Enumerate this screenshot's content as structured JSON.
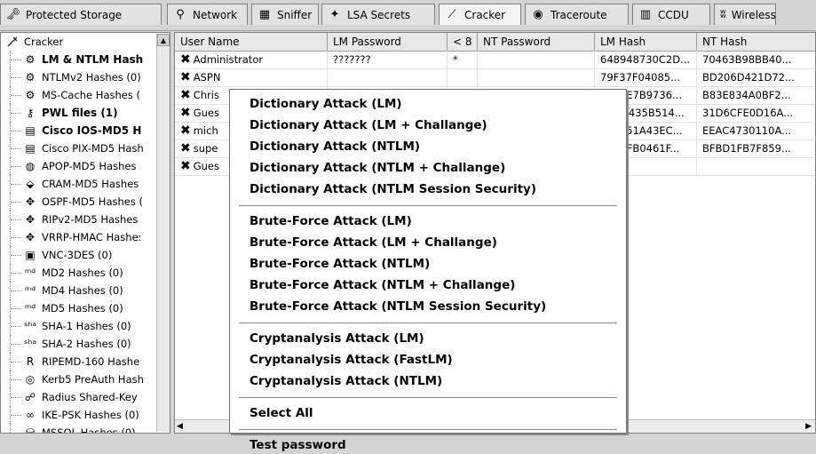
{
  "tabs": [
    {
      "label": "Protected Storage",
      "icon": "key-icon"
    },
    {
      "label": "Network",
      "icon": "network-icon"
    },
    {
      "label": "Sniffer",
      "icon": "sniffer-icon"
    },
    {
      "label": "LSA Secrets",
      "icon": "lsa-icon"
    },
    {
      "label": "Cracker",
      "icon": "cracker-icon"
    },
    {
      "label": "Traceroute",
      "icon": "traceroute-icon"
    },
    {
      "label": "CCDU",
      "icon": "ccdu-icon"
    },
    {
      "label": "Wireless",
      "icon": "wireless-icon"
    }
  ],
  "tree": {
    "root": "Cracker",
    "items": [
      {
        "label": "LM & NTLM Hash",
        "bold": true,
        "icon": "hash-icon"
      },
      {
        "label": "NTLMv2 Hashes (0)",
        "bold": false,
        "icon": "hash-icon"
      },
      {
        "label": "MS-Cache Hashes (",
        "bold": false,
        "icon": "hash-icon"
      },
      {
        "label": "PWL files (1)",
        "bold": true,
        "icon": "pwl-icon"
      },
      {
        "label": "Cisco IOS-MD5 H",
        "bold": true,
        "icon": "cisco-icon"
      },
      {
        "label": "Cisco PIX-MD5 Hash",
        "bold": false,
        "icon": "cisco-icon"
      },
      {
        "label": "APOP-MD5 Hashes",
        "bold": false,
        "icon": "apop-icon"
      },
      {
        "label": "CRAM-MD5 Hashes",
        "bold": false,
        "icon": "cram-icon"
      },
      {
        "label": "OSPF-MD5 Hashes (",
        "bold": false,
        "icon": "cross-arrows-icon"
      },
      {
        "label": "RIPv2-MD5 Hashes",
        "bold": false,
        "icon": "cross-arrows-icon"
      },
      {
        "label": "VRRP-HMAC Hashe:",
        "bold": false,
        "icon": "cross-arrows-icon"
      },
      {
        "label": "VNC-3DES (0)",
        "bold": false,
        "icon": "vnc-icon"
      },
      {
        "label": "MD2 Hashes (0)",
        "bold": false,
        "icon": "md-icon"
      },
      {
        "label": "MD4 Hashes (0)",
        "bold": false,
        "icon": "md-icon"
      },
      {
        "label": "MD5 Hashes (0)",
        "bold": false,
        "icon": "md-icon"
      },
      {
        "label": "SHA-1 Hashes (0)",
        "bold": false,
        "icon": "sha-icon"
      },
      {
        "label": "SHA-2 Hashes (0)",
        "bold": false,
        "icon": "sha-icon"
      },
      {
        "label": "RIPEMD-160 Hashe",
        "bold": false,
        "icon": "ripemd-icon"
      },
      {
        "label": "Kerb5 PreAuth Hash",
        "bold": false,
        "icon": "kerberos-icon"
      },
      {
        "label": "Radius Shared-Key",
        "bold": false,
        "icon": "radius-icon"
      },
      {
        "label": "IKE-PSK Hashes (0)",
        "bold": false,
        "icon": "ike-icon"
      },
      {
        "label": "MSSQL Hashes (0)",
        "bold": false,
        "icon": "mssql-icon"
      }
    ]
  },
  "table": {
    "headers": [
      "User Name",
      "LM Password",
      "< 8",
      "NT Password",
      "LM Hash",
      "NT Hash"
    ],
    "rows": [
      [
        "Administrator",
        "???????",
        "*",
        "",
        "648948730C2D...",
        "70463B98BB40..."
      ],
      [
        "ASPN",
        "",
        "",
        "",
        "79F37F04085...",
        "BD206D421D72..."
      ],
      [
        "Chris",
        "",
        "",
        "",
        "5019E7B9736...",
        "B83E834A0BF2..."
      ],
      [
        "Gues",
        "",
        "",
        "",
        "AD3B435B514...",
        "31D6CFE0D16A..."
      ],
      [
        "mich",
        "",
        "",
        "",
        "971351A43EC...",
        "EEAC4730110A..."
      ],
      [
        "supe",
        "",
        "",
        "",
        "94A4FB0461F...",
        "BFBD1FB7F859..."
      ],
      [
        "Gues",
        "",
        "",
        "",
        "",
        ""
      ]
    ]
  },
  "context_menu": {
    "groups": [
      [
        "Dictionary Attack (LM)",
        "Dictionary Attack (LM + Challange)",
        "Dictionary Attack (NTLM)",
        "Dictionary Attack (NTLM + Challange)",
        "Dictionary Attack (NTLM Session Security)"
      ],
      [
        "Brute-Force Attack (LM)",
        "Brute-Force Attack (LM + Challange)",
        "Brute-Force Attack (NTLM)",
        "Brute-Force Attack (NTLM + Challange)",
        "Brute-Force Attack (NTLM Session Security)"
      ],
      [
        "Cryptanalysis Attack (LM)",
        "Cryptanalysis Attack (FastLM)",
        "Cryptanalysis Attack (NTLM)"
      ],
      [
        "Select All"
      ],
      [
        "Test password"
      ]
    ]
  }
}
